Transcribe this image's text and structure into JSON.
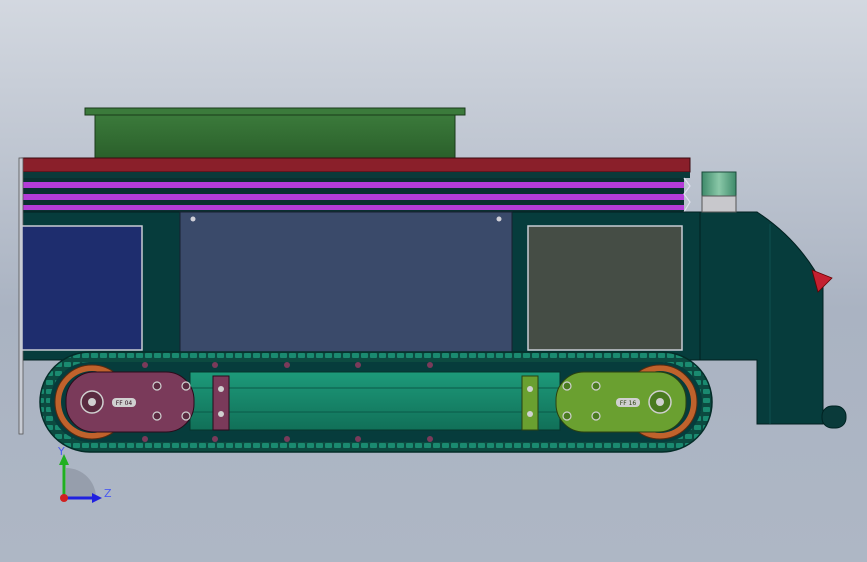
{
  "viewport": {
    "background_top": "#d3d8e0",
    "background_bottom": "#aeb7c5"
  },
  "model": {
    "plate_left_label": "FF 04",
    "plate_right_label": "FF 16",
    "colors": {
      "body_dark_teal": "#063c3c",
      "top_box_green": "#2f6b2f",
      "lid_red": "#8a1f2a",
      "stripe_magenta": "#b43cd8",
      "center_panel": "#3a4a6a",
      "left_panel": "#1e2d6e",
      "right_panel": "#454d45",
      "track_teal": "#1a8a70",
      "sprocket_orange": "#c0622c",
      "plate_purple": "#7a3a5a",
      "plate_olive": "#6aa030",
      "beacon_green": "#5aa080",
      "nose_red": "#c42030"
    }
  },
  "triad": {
    "y_label": "Y",
    "z_label": "Z",
    "y_color": "#20b020",
    "z_color": "#2020e0",
    "x_color": "#d02020"
  }
}
